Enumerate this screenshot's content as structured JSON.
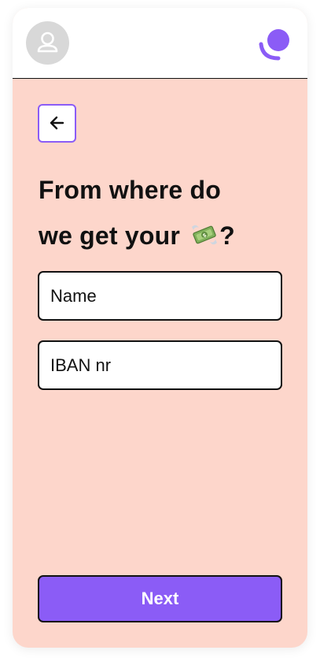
{
  "header": {
    "avatar_icon": "user-icon",
    "logo_icon": "brand-logo-icon"
  },
  "back": {
    "icon": "arrow-left-icon"
  },
  "title": {
    "line1": "From where do",
    "line2_prefix": "we get your ",
    "emoji_icon": "money-with-wings-icon",
    "line2_suffix": "?"
  },
  "form": {
    "name_placeholder": "Name",
    "iban_placeholder": "IBAN nr"
  },
  "actions": {
    "next_label": "Next"
  },
  "colors": {
    "accent": "#8b5cf6",
    "background": "#fdd6cb",
    "border": "#111111",
    "avatar_bg": "#d8d8d8"
  }
}
